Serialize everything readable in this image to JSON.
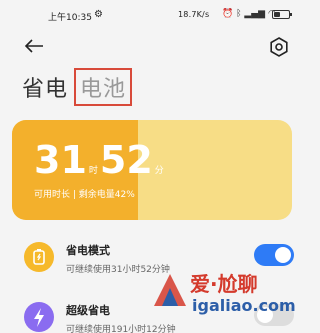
{
  "status_bar": {
    "time": "上午10:35",
    "speed": "18.7K/s",
    "icons": [
      "gear-icon",
      "alarm-icon",
      "bluetooth-icon",
      "signal-icon",
      "wifi-icon",
      "battery-icon"
    ]
  },
  "header": {
    "tab_power": "省电",
    "tab_battery": "电池"
  },
  "battery_card": {
    "hours": "31",
    "hours_unit": "时",
    "minutes": "52",
    "minutes_unit": "分",
    "subtitle": "可用时长 | 剩余电量42%",
    "remaining_fraction": 0.45,
    "color_main": "#f3b02c",
    "color_bg": "#f7dd86"
  },
  "items": [
    {
      "title": "省电模式",
      "desc": "可继续使用31小时52分钟",
      "icon": "power-saving-icon",
      "icon_color": "#f6b92b",
      "toggle_on": true,
      "toggle_color": "#2e7bf6"
    },
    {
      "title": "超级省电",
      "desc": "可继续使用191小时12分钟",
      "icon": "lightning-icon",
      "icon_color": "#8a6cf0",
      "toggle_on": false,
      "toggle_color": "#dddddd"
    }
  ],
  "watermark": {
    "title": "爱·尬聊",
    "url": "igaliao.com"
  }
}
